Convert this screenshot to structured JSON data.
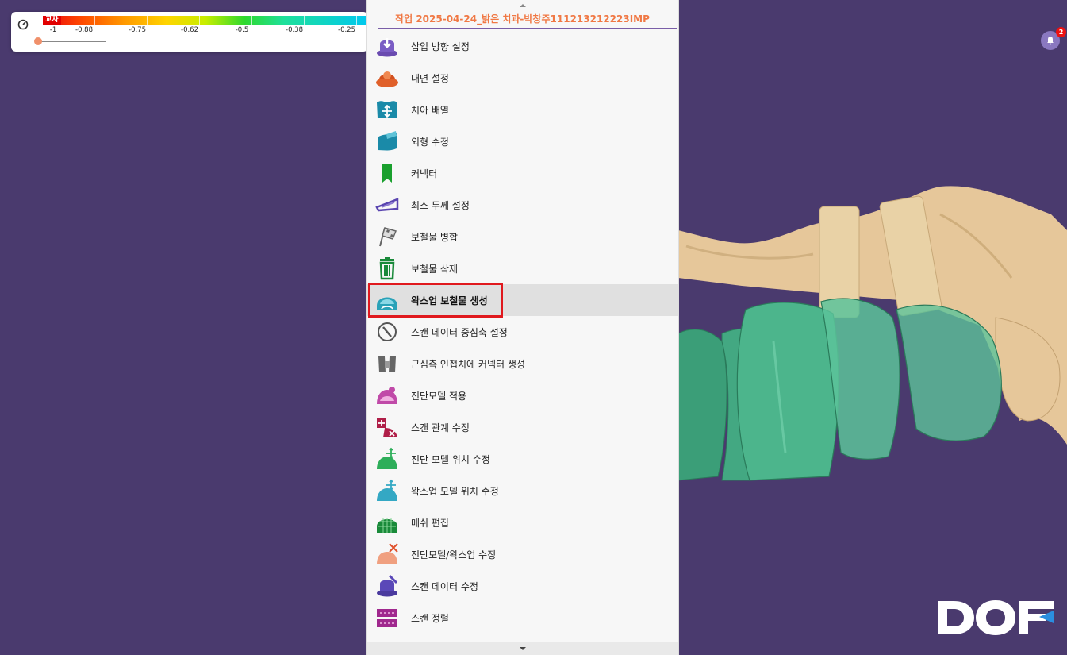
{
  "scale": {
    "label": "교차",
    "ticks": [
      "-1",
      "-0.88",
      "-0.75",
      "-0.62",
      "-0.5",
      "-0.38",
      "-0.25"
    ],
    "slider_value": 0
  },
  "menu": {
    "title": "작업 2025-04-24_밝은 치과-박창주111213212223IMP",
    "items": [
      {
        "label": "삽입 방향 설정",
        "icon": "insertion-direction-icon"
      },
      {
        "label": "내면 설정",
        "icon": "inner-surface-icon"
      },
      {
        "label": "치아 배열",
        "icon": "tooth-arrangement-icon"
      },
      {
        "label": "외형 수정",
        "icon": "shape-edit-icon"
      },
      {
        "label": "커넥터",
        "icon": "connector-icon"
      },
      {
        "label": "최소 두께 설정",
        "icon": "thickness-icon"
      },
      {
        "label": "보철물 병합",
        "icon": "merge-flag-icon"
      },
      {
        "label": "보철물 삭제",
        "icon": "trash-icon"
      },
      {
        "label": "왁스업 보철물 생성",
        "icon": "waxup-create-icon"
      },
      {
        "label": "스캔 데이터 중심축 설정",
        "icon": "axis-icon"
      },
      {
        "label": "근심측 인접치에 커넥터 생성",
        "icon": "adjacent-connector-icon"
      },
      {
        "label": "진단모델 적용",
        "icon": "diagnostic-model-icon"
      },
      {
        "label": "스캔 관계 수정",
        "icon": "scan-relation-icon"
      },
      {
        "label": "진단 모델 위치 수정",
        "icon": "diagnostic-position-icon"
      },
      {
        "label": "왁스업 모델 위치 수정",
        "icon": "waxup-position-icon"
      },
      {
        "label": "메쉬 편집",
        "icon": "mesh-edit-icon"
      },
      {
        "label": "진단모델/왁스업 수정",
        "icon": "diagnostic-waxup-edit-icon"
      },
      {
        "label": "스캔 데이터 수정",
        "icon": "scan-data-edit-icon"
      },
      {
        "label": "스캔 정렬",
        "icon": "scan-align-icon"
      }
    ],
    "selected_index": 8
  },
  "notifications": {
    "count": "2"
  },
  "logo": {
    "text": "DOF"
  },
  "colors": {
    "background": "#4a3a6e",
    "title": "#f07844",
    "highlight": "#e0191e"
  }
}
